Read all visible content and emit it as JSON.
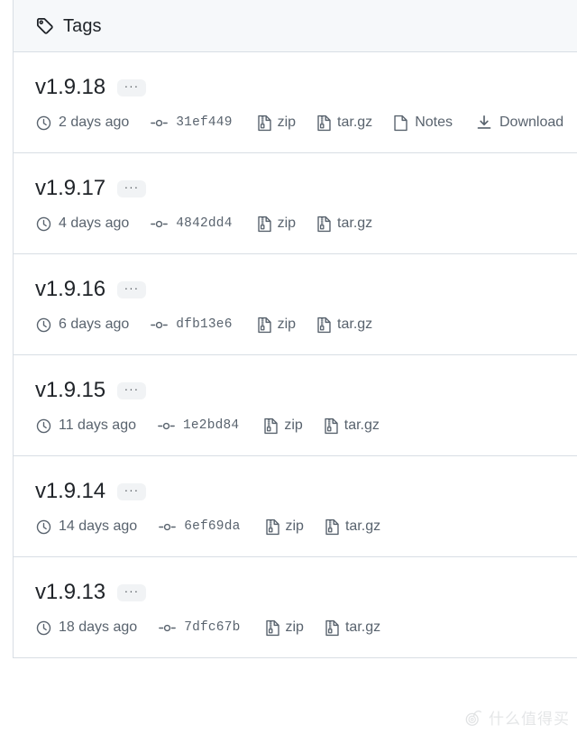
{
  "header": {
    "icon": "tag-icon",
    "title": "Tags"
  },
  "labels": {
    "kebab": "···",
    "clock_icon": "clock-icon",
    "commit_icon": "git-commit-icon",
    "zip_icon": "file-zip-icon",
    "targz_icon": "file-zip-icon",
    "notes_icon": "file-icon",
    "download_icon": "download-icon"
  },
  "tags": [
    {
      "name": "v1.9.18",
      "kebab": "···",
      "date": "2 days ago",
      "commit": "31ef449",
      "zip": "zip",
      "targz": "tar.gz",
      "notes": "Notes",
      "download": "Download"
    },
    {
      "name": "v1.9.17",
      "kebab": "···",
      "date": "4 days ago",
      "commit": "4842dd4",
      "zip": "zip",
      "targz": "tar.gz"
    },
    {
      "name": "v1.9.16",
      "kebab": "···",
      "date": "6 days ago",
      "commit": "dfb13e6",
      "zip": "zip",
      "targz": "tar.gz"
    },
    {
      "name": "v1.9.15",
      "kebab": "···",
      "date": "11 days ago",
      "commit": "1e2bd84",
      "zip": "zip",
      "targz": "tar.gz"
    },
    {
      "name": "v1.9.14",
      "kebab": "···",
      "date": "14 days ago",
      "commit": "6ef69da",
      "zip": "zip",
      "targz": "tar.gz"
    },
    {
      "name": "v1.9.13",
      "kebab": "···",
      "date": "18 days ago",
      "commit": "7dfc67b",
      "zip": "zip",
      "targz": "tar.gz"
    }
  ],
  "watermark": {
    "text": "什么值得买"
  },
  "colors": {
    "text": "#1f2328",
    "muted": "#59636e",
    "border": "#d8dee4",
    "header_bg": "#f6f8fa",
    "kebab_bg": "#f1f3f5"
  }
}
